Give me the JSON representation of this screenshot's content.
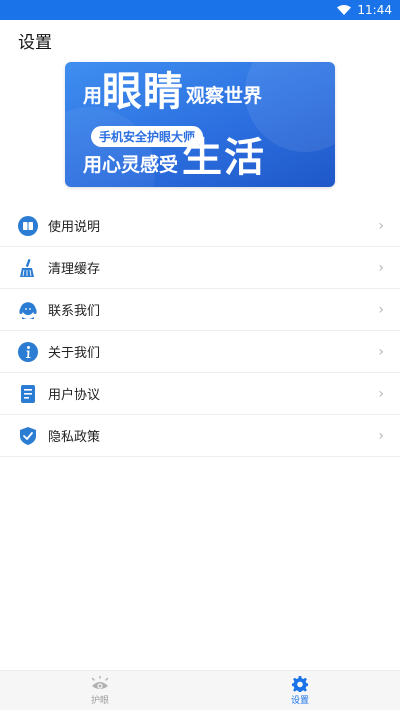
{
  "status_bar": {
    "time": "11:44",
    "background": "#1a73e8"
  },
  "header": {
    "title": "设置"
  },
  "banner": {
    "line1_prefix": "用",
    "line1_big": "眼睛",
    "line1_suffix": "观察世界",
    "pill": "手机安全护眼大师",
    "line3_prefix": "用心灵感受",
    "line3_big": "生活"
  },
  "menu": [
    {
      "label": "使用说明",
      "icon": "book-icon"
    },
    {
      "label": "清理缓存",
      "icon": "broom-icon"
    },
    {
      "label": "联系我们",
      "icon": "headset-icon"
    },
    {
      "label": "关于我们",
      "icon": "info-icon"
    },
    {
      "label": "用户协议",
      "icon": "document-icon"
    },
    {
      "label": "隐私政策",
      "icon": "shield-icon"
    }
  ],
  "chevron": "›",
  "tabbar": {
    "tabs": [
      {
        "label": "护眼",
        "icon": "eye-icon",
        "active": false
      },
      {
        "label": "设置",
        "icon": "gear-icon",
        "active": true
      }
    ]
  },
  "colors": {
    "accent": "#1a73e8",
    "icon_blue": "#2b7cd3"
  }
}
